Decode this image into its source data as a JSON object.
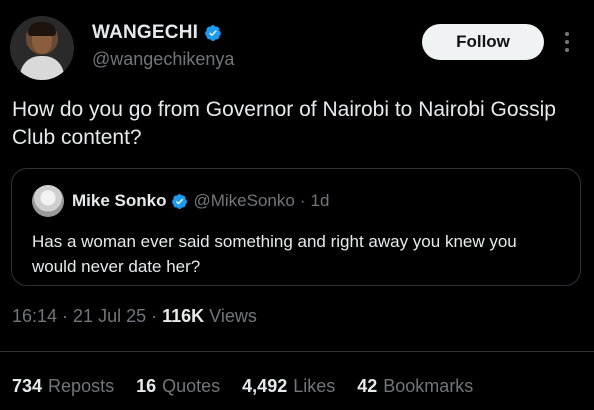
{
  "author": {
    "display_name": "WANGECHI",
    "handle": "@wangechikenya",
    "verified_color": "#1d9bf0"
  },
  "follow_label": "Follow",
  "tweet": {
    "text": "How do you go from Governor of Nairobi to Nairobi Gossip Club content?"
  },
  "quoted": {
    "display_name": "Mike Sonko",
    "handle": "@MikeSonko",
    "separator": "·",
    "time": "1d",
    "text": "Has a woman ever said something and right away you knew you would never date her?"
  },
  "meta": {
    "time": "16:14",
    "sep1": "·",
    "date": "21 Jul 25",
    "sep2": "·",
    "views_count": "116K",
    "views_label": "Views"
  },
  "stats": {
    "reposts_count": "734",
    "reposts_label": "Reposts",
    "quotes_count": "16",
    "quotes_label": "Quotes",
    "likes_count": "4,492",
    "likes_label": "Likes",
    "bookmarks_count": "42",
    "bookmarks_label": "Bookmarks"
  }
}
